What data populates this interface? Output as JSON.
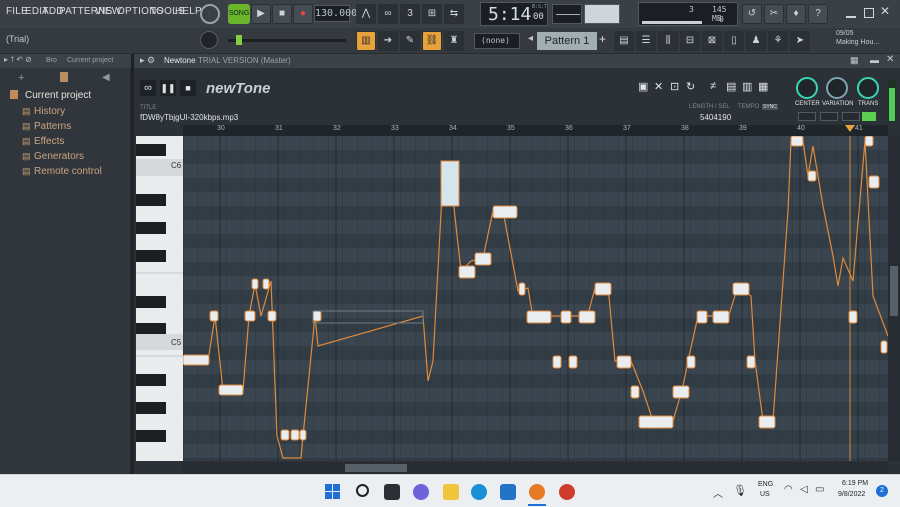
{
  "menu": {
    "items": [
      "FILE",
      "EDIT",
      "ADD",
      "PATTERNS",
      "VIEW",
      "OPTIONS",
      "TOOLS",
      "HELP"
    ]
  },
  "transport": {
    "song_label": "SONG",
    "bpm": "130.000",
    "time": "5:14",
    "time_small": "00",
    "time_label": "B:S:T"
  },
  "stats": {
    "cpu_num": "3",
    "mem": "145 MB",
    "zero": "0"
  },
  "hint": {
    "left": "(Trial)"
  },
  "pattern": {
    "none": "(none)",
    "name": "Pattern 1"
  },
  "project": {
    "date": "09/05",
    "name": "Making Hou..."
  },
  "browser": {
    "tab1": "Bro",
    "tab2": "Current project",
    "root": "Current project",
    "items": [
      "History",
      "Patterns",
      "Effects",
      "Generators",
      "Remote control"
    ]
  },
  "plugin": {
    "title": "Newtone",
    "subtitle": "TRIAL VERSION (Master)",
    "logo": "newTone",
    "title_label": "TITLE",
    "file": "fDW8yTbjgUI-320kbps.mp3",
    "length_label": "LENGTH / SEL",
    "length_value": "5404190",
    "tempo_label": "TEMPO",
    "sync_label": "SYNC",
    "center": "CENTER",
    "variation": "VARIATION",
    "trans": "TRANS"
  },
  "ruler": {
    "bars": [
      "30",
      "31",
      "32",
      "33",
      "34",
      "35",
      "36",
      "37",
      "38",
      "39",
      "40",
      "41"
    ]
  },
  "keys": {
    "c6": "C6",
    "c5": "C5"
  },
  "taskbar": {
    "lang1": "ENG",
    "lang2": "US",
    "time": "6:19 PM",
    "date": "9/8/2022",
    "badge": "2"
  },
  "colors": {
    "accent": "#e7a23c",
    "lcd": "#1b1f23",
    "note": "#e08a3b",
    "knob": "#39d6b4"
  }
}
